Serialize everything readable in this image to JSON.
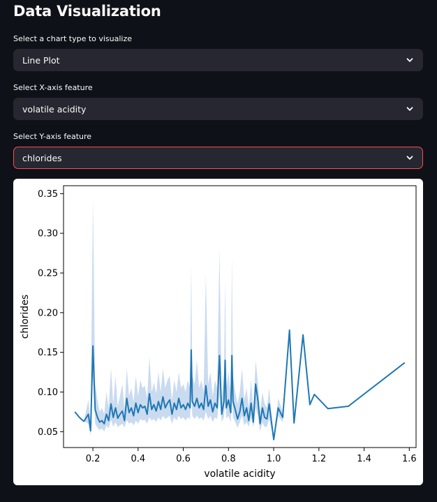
{
  "page": {
    "title": "Data Visualization"
  },
  "controls": {
    "chart_type": {
      "label": "Select a chart type to visualize",
      "value": "Line Plot"
    },
    "x_feature": {
      "label": "Select X-axis feature",
      "value": "volatile acidity"
    },
    "y_feature": {
      "label": "Select Y-axis feature",
      "value": "chlorides"
    }
  },
  "icons": {
    "dropdown": "chevron-down-icon"
  },
  "colors": {
    "background": "#0e1117",
    "select_bg": "#262730",
    "focus_border": "#ff4b4b",
    "line": "#1f77b4",
    "band": "#aec7e8"
  },
  "chart_data": {
    "type": "line",
    "xlabel": "volatile acidity",
    "ylabel": "chlorides",
    "xlim": [
      0.07,
      1.63
    ],
    "ylim": [
      0.03,
      0.36
    ],
    "xticks": [
      0.2,
      0.4,
      0.6,
      0.8,
      1.0,
      1.2,
      1.4,
      1.6
    ],
    "yticks": [
      0.05,
      0.1,
      0.15,
      0.2,
      0.25,
      0.3,
      0.35
    ],
    "series": [
      {
        "x": [
          0.12,
          0.14,
          0.16,
          0.18,
          0.19,
          0.2,
          0.21,
          0.22,
          0.23,
          0.24,
          0.25,
          0.26,
          0.27,
          0.28,
          0.29,
          0.3,
          0.31,
          0.32,
          0.33,
          0.34,
          0.35,
          0.36,
          0.37,
          0.38,
          0.39,
          0.4,
          0.41,
          0.42,
          0.43,
          0.44,
          0.45,
          0.46,
          0.47,
          0.48,
          0.49,
          0.5,
          0.51,
          0.52,
          0.53,
          0.54,
          0.55,
          0.56,
          0.57,
          0.58,
          0.59,
          0.6,
          0.61,
          0.62,
          0.63,
          0.635,
          0.64,
          0.65,
          0.66,
          0.67,
          0.68,
          0.69,
          0.7,
          0.71,
          0.72,
          0.73,
          0.74,
          0.75,
          0.76,
          0.77,
          0.78,
          0.785,
          0.79,
          0.8,
          0.81,
          0.815,
          0.82,
          0.83,
          0.84,
          0.85,
          0.86,
          0.87,
          0.88,
          0.89,
          0.9,
          0.91,
          0.92,
          0.93,
          0.94,
          0.95,
          0.96,
          0.97,
          0.98,
          1.0,
          1.02,
          1.04,
          1.07,
          1.09,
          1.13,
          1.16,
          1.18,
          1.24,
          1.33,
          1.58
        ],
        "y": [
          0.075,
          0.068,
          0.063,
          0.072,
          0.051,
          0.158,
          0.078,
          0.068,
          0.062,
          0.064,
          0.06,
          0.072,
          0.064,
          0.085,
          0.068,
          0.08,
          0.067,
          0.072,
          0.076,
          0.064,
          0.092,
          0.074,
          0.08,
          0.07,
          0.086,
          0.074,
          0.084,
          0.08,
          0.082,
          0.072,
          0.098,
          0.078,
          0.084,
          0.076,
          0.088,
          0.078,
          0.094,
          0.08,
          0.086,
          0.09,
          0.072,
          0.086,
          0.078,
          0.092,
          0.08,
          0.084,
          0.078,
          0.086,
          0.08,
          0.153,
          0.088,
          0.082,
          0.092,
          0.08,
          0.086,
          0.078,
          0.108,
          0.082,
          0.09,
          0.075,
          0.086,
          0.08,
          0.146,
          0.072,
          0.088,
          0.14,
          0.08,
          0.09,
          0.074,
          0.146,
          0.088,
          0.078,
          0.066,
          0.075,
          0.092,
          0.07,
          0.08,
          0.064,
          0.086,
          0.062,
          0.11,
          0.09,
          0.06,
          0.08,
          0.068,
          0.066,
          0.085,
          0.04,
          0.08,
          0.068,
          0.178,
          0.061,
          0.172,
          0.084,
          0.097,
          0.079,
          0.082,
          0.137
        ],
        "lower": [
          0.075,
          0.068,
          0.063,
          0.06,
          0.045,
          0.12,
          0.06,
          0.055,
          0.052,
          0.054,
          0.05,
          0.058,
          0.054,
          0.065,
          0.056,
          0.062,
          0.056,
          0.058,
          0.06,
          0.055,
          0.065,
          0.06,
          0.062,
          0.058,
          0.064,
          0.06,
          0.066,
          0.064,
          0.065,
          0.06,
          0.068,
          0.064,
          0.066,
          0.062,
          0.068,
          0.064,
          0.07,
          0.066,
          0.068,
          0.07,
          0.06,
          0.068,
          0.064,
          0.07,
          0.066,
          0.068,
          0.064,
          0.068,
          0.066,
          0.1,
          0.07,
          0.066,
          0.07,
          0.066,
          0.068,
          0.064,
          0.075,
          0.066,
          0.07,
          0.062,
          0.068,
          0.066,
          0.095,
          0.062,
          0.068,
          0.09,
          0.066,
          0.07,
          0.062,
          0.095,
          0.068,
          0.062,
          0.055,
          0.062,
          0.07,
          0.058,
          0.062,
          0.056,
          0.068,
          0.055,
          0.08,
          0.07,
          0.05,
          0.062,
          0.056,
          0.056,
          0.066,
          0.04,
          0.07,
          0.062,
          0.178,
          0.061,
          0.172,
          0.084,
          0.097,
          0.079,
          0.082,
          0.137
        ],
        "upper": [
          0.075,
          0.068,
          0.063,
          0.09,
          0.06,
          0.343,
          0.11,
          0.09,
          0.075,
          0.08,
          0.072,
          0.1,
          0.08,
          0.13,
          0.085,
          0.12,
          0.082,
          0.095,
          0.11,
          0.078,
          0.13,
          0.095,
          0.105,
          0.088,
          0.12,
          0.095,
          0.115,
          0.105,
          0.108,
          0.092,
          0.145,
          0.1,
          0.112,
          0.098,
          0.125,
          0.1,
          0.13,
          0.105,
          0.115,
          0.12,
          0.09,
          0.115,
          0.1,
          0.125,
          0.105,
          0.11,
          0.1,
          0.115,
          0.105,
          0.26,
          0.12,
          0.11,
          0.14,
          0.105,
          0.115,
          0.1,
          0.248,
          0.11,
          0.125,
          0.095,
          0.115,
          0.105,
          0.281,
          0.092,
          0.12,
          0.24,
          0.105,
          0.125,
          0.095,
          0.27,
          0.12,
          0.1,
          0.085,
          0.1,
          0.13,
          0.09,
          0.105,
          0.08,
          0.115,
          0.078,
          0.14,
          0.112,
          0.075,
          0.1,
          0.085,
          0.08,
          0.105,
          0.04,
          0.092,
          0.075,
          0.178,
          0.061,
          0.172,
          0.084,
          0.097,
          0.079,
          0.082,
          0.137
        ]
      }
    ]
  }
}
